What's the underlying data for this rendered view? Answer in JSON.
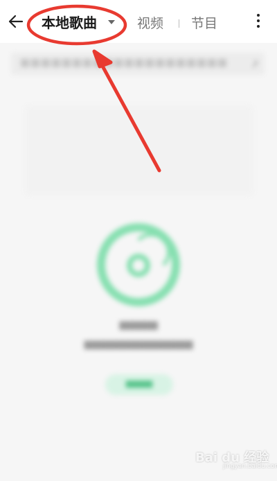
{
  "header": {
    "tabs": [
      {
        "label": "本地歌曲",
        "active": true
      },
      {
        "label": "视频",
        "active": false
      },
      {
        "label": "节目",
        "active": false
      }
    ],
    "icons": {
      "back": "back-arrow-icon",
      "dropdown": "caret-down-icon",
      "more": "more-vertical-icon"
    }
  },
  "colors": {
    "accent": "#86dfb0",
    "annotation": "#e83a30"
  },
  "annotation": {
    "type": "ellipse-with-arrow",
    "target": "tab-local-songs"
  },
  "watermark": {
    "text": "Bai du 经验",
    "sub": "jingyan.baidu.com"
  }
}
